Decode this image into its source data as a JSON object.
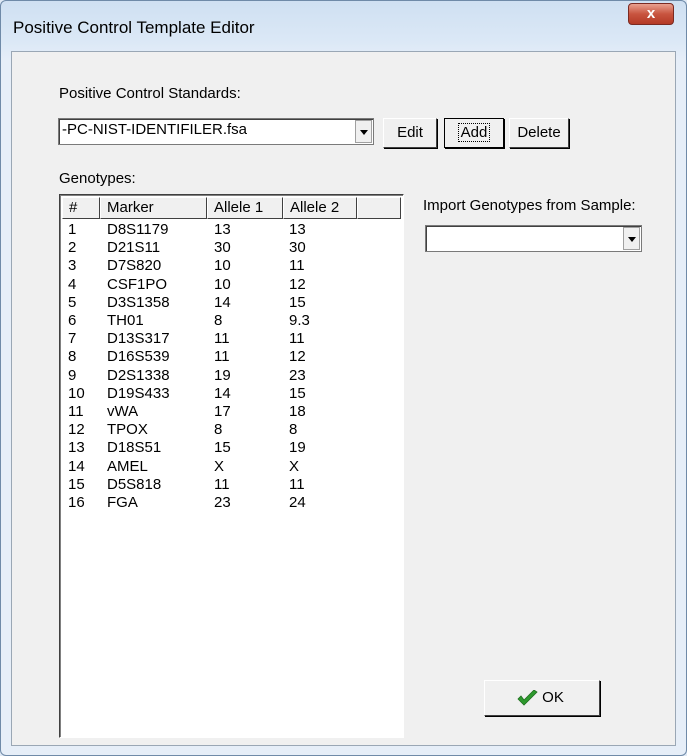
{
  "window": {
    "title": "Positive Control Template Editor",
    "close_glyph": "x"
  },
  "standards": {
    "label": "Positive Control Standards:",
    "selected": "-PC-NIST-IDENTIFILER.fsa",
    "edit_label": "Edit",
    "add_label": "Add",
    "delete_label": "Delete"
  },
  "genotypes": {
    "label": "Genotypes:",
    "columns": [
      "#",
      "Marker",
      "Allele 1",
      "Allele 2"
    ],
    "rows": [
      [
        "1",
        "D8S1179",
        "13",
        "13"
      ],
      [
        "2",
        "D21S11",
        "30",
        "30"
      ],
      [
        "3",
        "D7S820",
        "10",
        "11"
      ],
      [
        "4",
        "CSF1PO",
        "10",
        "12"
      ],
      [
        "5",
        "D3S1358",
        "14",
        "15"
      ],
      [
        "6",
        "TH01",
        "8",
        "9.3"
      ],
      [
        "7",
        "D13S317",
        "11",
        "11"
      ],
      [
        "8",
        "D16S539",
        "11",
        "12"
      ],
      [
        "9",
        "D2S1338",
        "19",
        "23"
      ],
      [
        "10",
        "D19S433",
        "14",
        "15"
      ],
      [
        "11",
        "vWA",
        "17",
        "18"
      ],
      [
        "12",
        "TPOX",
        "8",
        "8"
      ],
      [
        "13",
        "D18S51",
        "15",
        "19"
      ],
      [
        "14",
        "AMEL",
        "X",
        "X"
      ],
      [
        "15",
        "D5S818",
        "11",
        "11"
      ],
      [
        "16",
        "FGA",
        "23",
        "24"
      ]
    ]
  },
  "import": {
    "label": "Import Genotypes from Sample:",
    "selected": ""
  },
  "ok": {
    "label": "OK",
    "icon": "checkmark-icon",
    "icon_color": "#2e9a2e"
  },
  "colors": {
    "close_button": "#c8543f",
    "dialog_bg": "#f0f0f0"
  }
}
